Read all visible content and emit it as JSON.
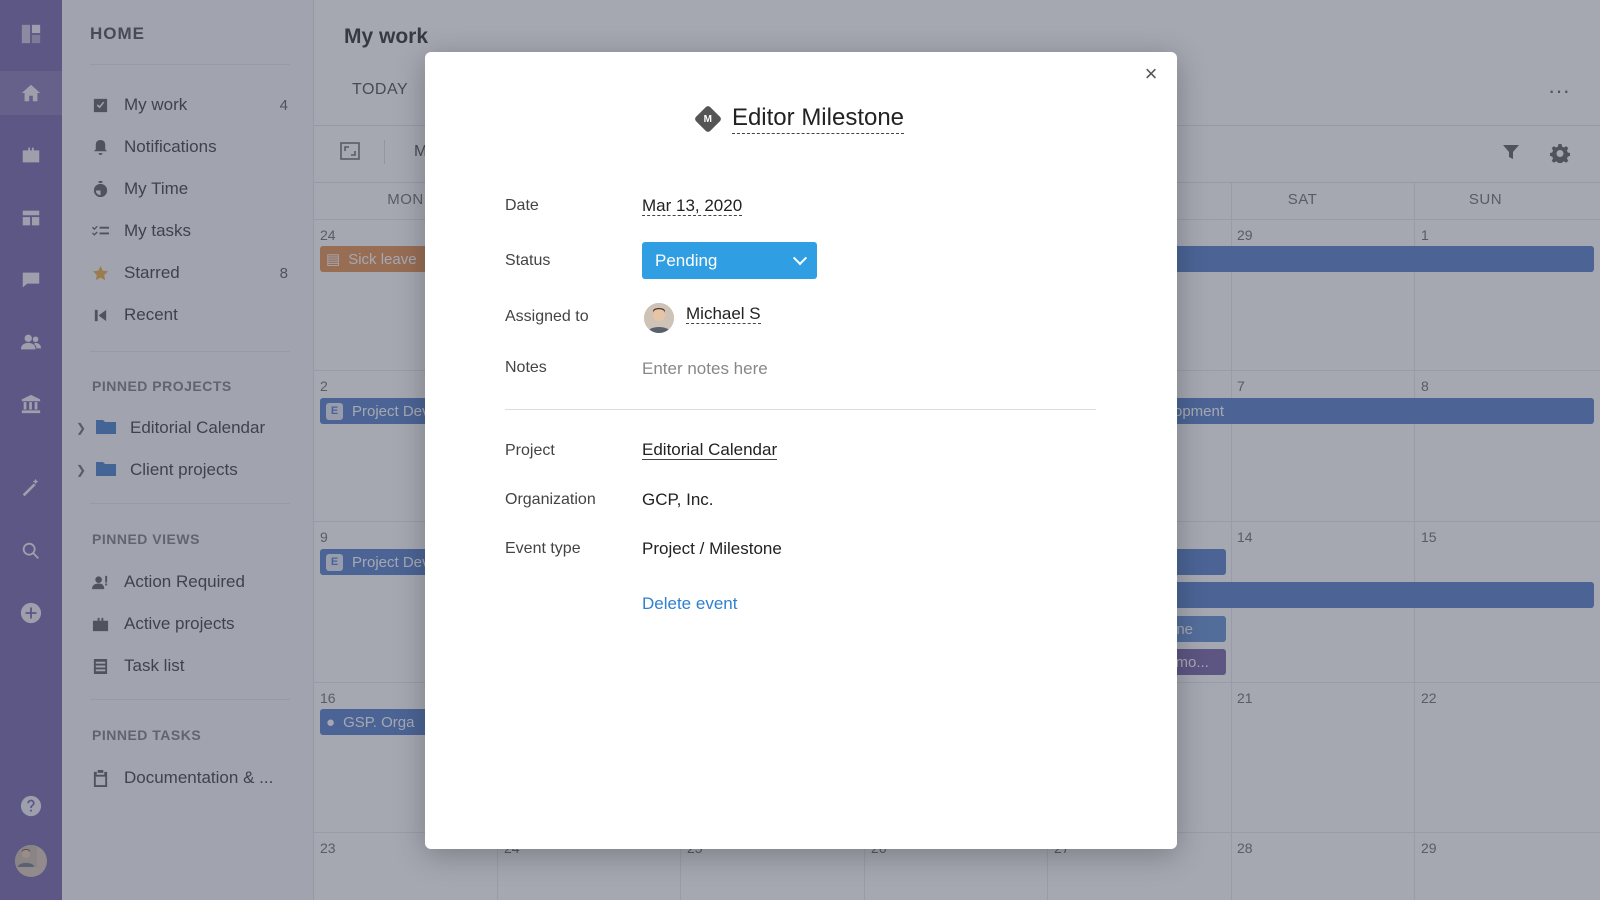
{
  "sidebar": {
    "home_label": "HOME",
    "items": [
      {
        "label": "My work",
        "count": "4",
        "icon": "checkbox-icon"
      },
      {
        "label": "Notifications",
        "count": "",
        "icon": "bell-icon"
      },
      {
        "label": "My Time",
        "count": "",
        "icon": "stopwatch-icon"
      },
      {
        "label": "My tasks",
        "count": "",
        "icon": "tasks-icon"
      },
      {
        "label": "Starred",
        "count": "8",
        "icon": "star-icon"
      },
      {
        "label": "Recent",
        "count": "",
        "icon": "recent-icon"
      }
    ],
    "pinned_projects_label": "PINNED PROJECTS",
    "pinned_projects": [
      {
        "label": "Editorial Calendar"
      },
      {
        "label": "Client projects"
      }
    ],
    "pinned_views_label": "PINNED VIEWS",
    "pinned_views": [
      {
        "label": "Action Required"
      },
      {
        "label": "Active projects"
      },
      {
        "label": "Task list"
      }
    ],
    "pinned_tasks_label": "PINNED TASKS",
    "pinned_tasks": [
      {
        "label": "Documentation & ..."
      }
    ]
  },
  "main": {
    "title": "My work",
    "tab_today": "TODAY",
    "more": "···",
    "toolbar_m": "M",
    "day_names": {
      "mon": "MON",
      "sat": "SAT",
      "sun": "SUN"
    },
    "weeks": [
      {
        "mon": "24",
        "sat": "29",
        "sun": "1"
      },
      {
        "mon": "2",
        "sat": "7",
        "sun": "8"
      },
      {
        "mon": "9",
        "sat": "14",
        "sun": "15"
      },
      {
        "mon": "16",
        "sat": "21",
        "sun": "22"
      },
      {
        "mon": "23",
        "tue": "24",
        "wed": "25",
        "thu": "26",
        "fri": "27",
        "sat": "28",
        "sun": "29"
      }
    ],
    "events": {
      "sick_leave": "Sick leave",
      "project_dev_1": "Project Dev",
      "project_dev_1_right": "opment",
      "project_dev_2": "Project Dev",
      "milestone_frag": "one",
      "testimonial_frag": "timo...",
      "gsp_org": "GSP. Orga",
      "badge_e": "E"
    },
    "colors": {
      "accent": "#2f9ee3",
      "rail": "#6c5fa6",
      "event_blue": "#4a78c6",
      "event_orange": "#e28a45",
      "event_purple": "#6e5aa0"
    }
  },
  "modal": {
    "title": "Editor Milestone",
    "title_badge": "M",
    "close": "×",
    "date_label": "Date",
    "date_value": "Mar 13, 2020",
    "status_label": "Status",
    "status_value": "Pending",
    "assigned_label": "Assigned to",
    "assigned_value": "Michael S",
    "notes_label": "Notes",
    "notes_placeholder": "Enter notes here",
    "project_label": "Project",
    "project_value": "Editorial Calendar",
    "organization_label": "Organization",
    "organization_value": "GCP, Inc.",
    "event_type_label": "Event type",
    "event_type_value": "Project / Milestone",
    "delete_label": "Delete event"
  }
}
